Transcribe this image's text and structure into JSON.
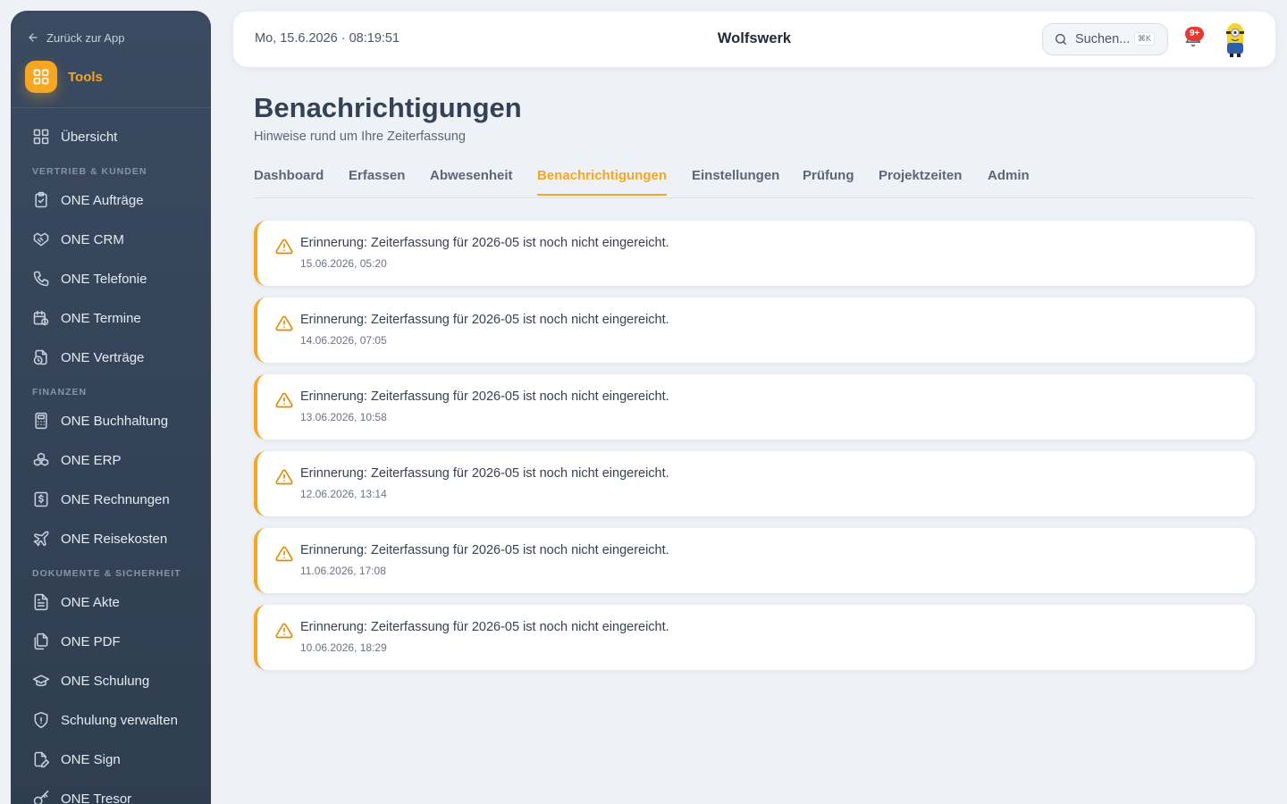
{
  "sidebar": {
    "back_label": "Zurück zur App",
    "tools_label": "Tools",
    "overview_label": "Übersicht",
    "sections": [
      "Vertrieb & Kunden",
      "Finanzen",
      "Dokumente & Sicherheit"
    ],
    "items": [
      {
        "label": "ONE Aufträge",
        "icon": "clipboard-check-icon"
      },
      {
        "label": "ONE CRM",
        "icon": "handshake-icon"
      },
      {
        "label": "ONE Telefonie",
        "icon": "phone-icon"
      },
      {
        "label": "ONE Termine",
        "icon": "calendar-clock-icon"
      },
      {
        "label": "ONE Verträge",
        "icon": "file-clock-icon"
      },
      {
        "label": "ONE Buchhaltung",
        "icon": "calculator-icon"
      },
      {
        "label": "ONE ERP",
        "icon": "boxes-icon"
      },
      {
        "label": "ONE Rechnungen",
        "icon": "receipt-dollar-icon"
      },
      {
        "label": "ONE Reisekosten",
        "icon": "plane-icon"
      },
      {
        "label": "ONE Akte",
        "icon": "file-text-icon"
      },
      {
        "label": "ONE PDF",
        "icon": "files-icon"
      },
      {
        "label": "ONE Schulung",
        "icon": "graduation-cap-icon"
      },
      {
        "label": "Schulung verwalten",
        "icon": "shield-icon"
      },
      {
        "label": "ONE Sign",
        "icon": "file-signature-icon"
      },
      {
        "label": "ONE Tresor",
        "icon": "key-icon"
      }
    ]
  },
  "header": {
    "datetime": "Mo, 15.6.2026 · 08:19:51",
    "company": "Wolfswerk",
    "search_placeholder": "Suchen...",
    "search_shortcut": "⌘K",
    "notification_badge": "9+"
  },
  "main": {
    "title": "Benachrichtigungen",
    "subtitle": "Hinweise rund um Ihre Zeiterfassung",
    "tabs": [
      "Dashboard",
      "Erfassen",
      "Abwesenheit",
      "Benachrichtigungen",
      "Einstellungen",
      "Prüfung",
      "Projektzeiten",
      "Admin"
    ],
    "active_tab": "Benachrichtigungen",
    "notifications": [
      {
        "message": "Erinnerung: Zeiterfassung für 2026-05 ist noch nicht eingereicht.",
        "timestamp": "15.06.2026, 05:20"
      },
      {
        "message": "Erinnerung: Zeiterfassung für 2026-05 ist noch nicht eingereicht.",
        "timestamp": "14.06.2026, 07:05"
      },
      {
        "message": "Erinnerung: Zeiterfassung für 2026-05 ist noch nicht eingereicht.",
        "timestamp": "13.06.2026, 10:58"
      },
      {
        "message": "Erinnerung: Zeiterfassung für 2026-05 ist noch nicht eingereicht.",
        "timestamp": "12.06.2026, 13:14"
      },
      {
        "message": "Erinnerung: Zeiterfassung für 2026-05 ist noch nicht eingereicht.",
        "timestamp": "11.06.2026, 17:08"
      },
      {
        "message": "Erinnerung: Zeiterfassung für 2026-05 ist noch nicht eingereicht.",
        "timestamp": "10.06.2026, 18:29"
      }
    ]
  },
  "colors": {
    "accent": "#f5a623",
    "sidebar": "#334256",
    "badge": "#e53935"
  }
}
